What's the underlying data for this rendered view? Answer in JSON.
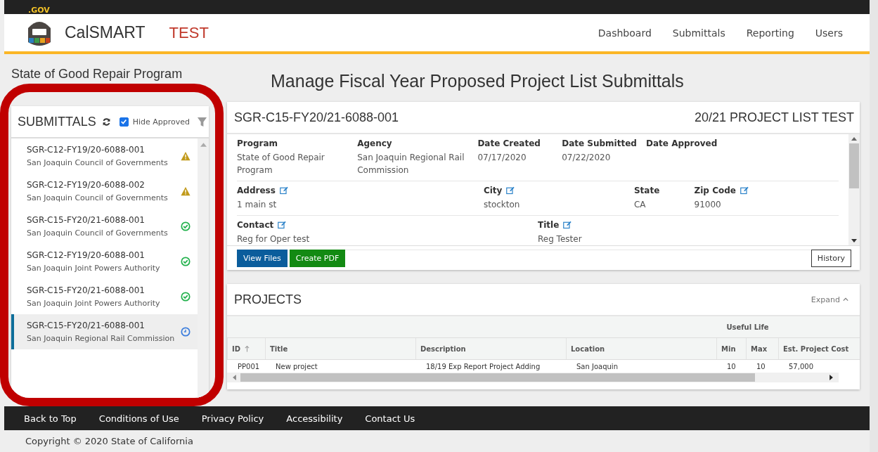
{
  "gov_badge": ".GOV",
  "header": {
    "app_name": "CalSMART",
    "environment": "TEST",
    "nav": [
      {
        "label": "Dashboard",
        "selected": false
      },
      {
        "label": "Submittals",
        "selected": false
      },
      {
        "label": "Reporting",
        "selected": false
      },
      {
        "label": "Users",
        "selected": false
      }
    ]
  },
  "program_heading": "State of Good Repair Program",
  "page_title": "Manage Fiscal Year Proposed Project List Submittals",
  "submittals": {
    "title": "SUBMITTALS",
    "hide_approved": {
      "label": "Hide Approved",
      "checked": true
    },
    "items": [
      {
        "code": "SGR-C12-FY19/20-6088-001",
        "agency": "San Joaquin Council of Governments",
        "kind": "warning",
        "selected": false
      },
      {
        "code": "SGR-C12-FY19/20-6088-002",
        "agency": "San Joaquin Council of Governments",
        "kind": "warning",
        "selected": false
      },
      {
        "code": "SGR-C15-FY20/21-6088-001",
        "agency": "San Joaquin Council of Governments",
        "kind": "approved",
        "selected": false
      },
      {
        "code": "SGR-C12-FY19/20-6088-001",
        "agency": "San Joaquin Joint Powers Authority",
        "kind": "approved",
        "selected": false
      },
      {
        "code": "SGR-C15-FY20/21-6088-001",
        "agency": "San Joaquin Joint Powers Authority",
        "kind": "approved",
        "selected": false
      },
      {
        "code": "SGR-C15-FY20/21-6088-001",
        "agency": "San Joaquin Regional Rail Commission",
        "kind": "pending",
        "selected": true
      }
    ]
  },
  "detail": {
    "code": "SGR-C15-FY20/21-6088-001",
    "list_title": "20/21 PROJECT LIST TEST",
    "rows": [
      {
        "fields": [
          {
            "label": "Program",
            "value": "State of Good Repair Program",
            "editable": false
          },
          {
            "label": "Agency",
            "value": "San Joaquin Regional Rail Commission",
            "editable": false
          },
          {
            "label": "Date Created",
            "value": "07/17/2020",
            "editable": false
          },
          {
            "label": "Date Submitted",
            "value": "07/22/2020",
            "editable": false
          },
          {
            "label": "Date Approved",
            "editable": false
          }
        ]
      },
      {
        "fields": [
          {
            "label": "Address",
            "value": "1 main st",
            "editable": true
          },
          {
            "label": "City",
            "value": "stockton",
            "editable": true
          },
          {
            "label": "State",
            "value": "CA",
            "editable": false
          },
          {
            "label": "Zip Code",
            "value": "91000",
            "editable": true
          }
        ]
      },
      {
        "fields": [
          {
            "label": "Contact",
            "value": "Reg for Oper test",
            "editable": true
          },
          {
            "label": "Title",
            "value": "Reg Tester",
            "editable": true
          }
        ]
      }
    ],
    "buttons": [
      {
        "label": "View Files",
        "kind": "primary"
      },
      {
        "label": "Create PDF",
        "kind": "success"
      },
      {
        "label": "History",
        "kind": "outline"
      }
    ]
  },
  "projects": {
    "title": "PROJECTS",
    "expand": "Expand",
    "group_header": "Useful Life",
    "columns": [
      {
        "label": "ID",
        "sorted": true
      },
      {
        "label": "Title",
        "sorted": false
      },
      {
        "label": "Description",
        "sorted": false
      },
      {
        "label": "Location",
        "sorted": false
      },
      {
        "label": "Min",
        "sorted": false
      },
      {
        "label": "Max",
        "sorted": false
      },
      {
        "label": "Est. Project Cost",
        "sorted": false
      }
    ],
    "rows": [
      [
        "PP001",
        "New project",
        "18/19 Exp Report Project Adding",
        "San Joaquin",
        "10",
        "10",
        "57,000"
      ]
    ]
  },
  "footer": {
    "links": [
      "Back to Top",
      "Conditions of Use",
      "Privacy Policy",
      "Accessibility",
      "Contact Us"
    ],
    "copyright": "Copyright © 2020 State of California"
  }
}
